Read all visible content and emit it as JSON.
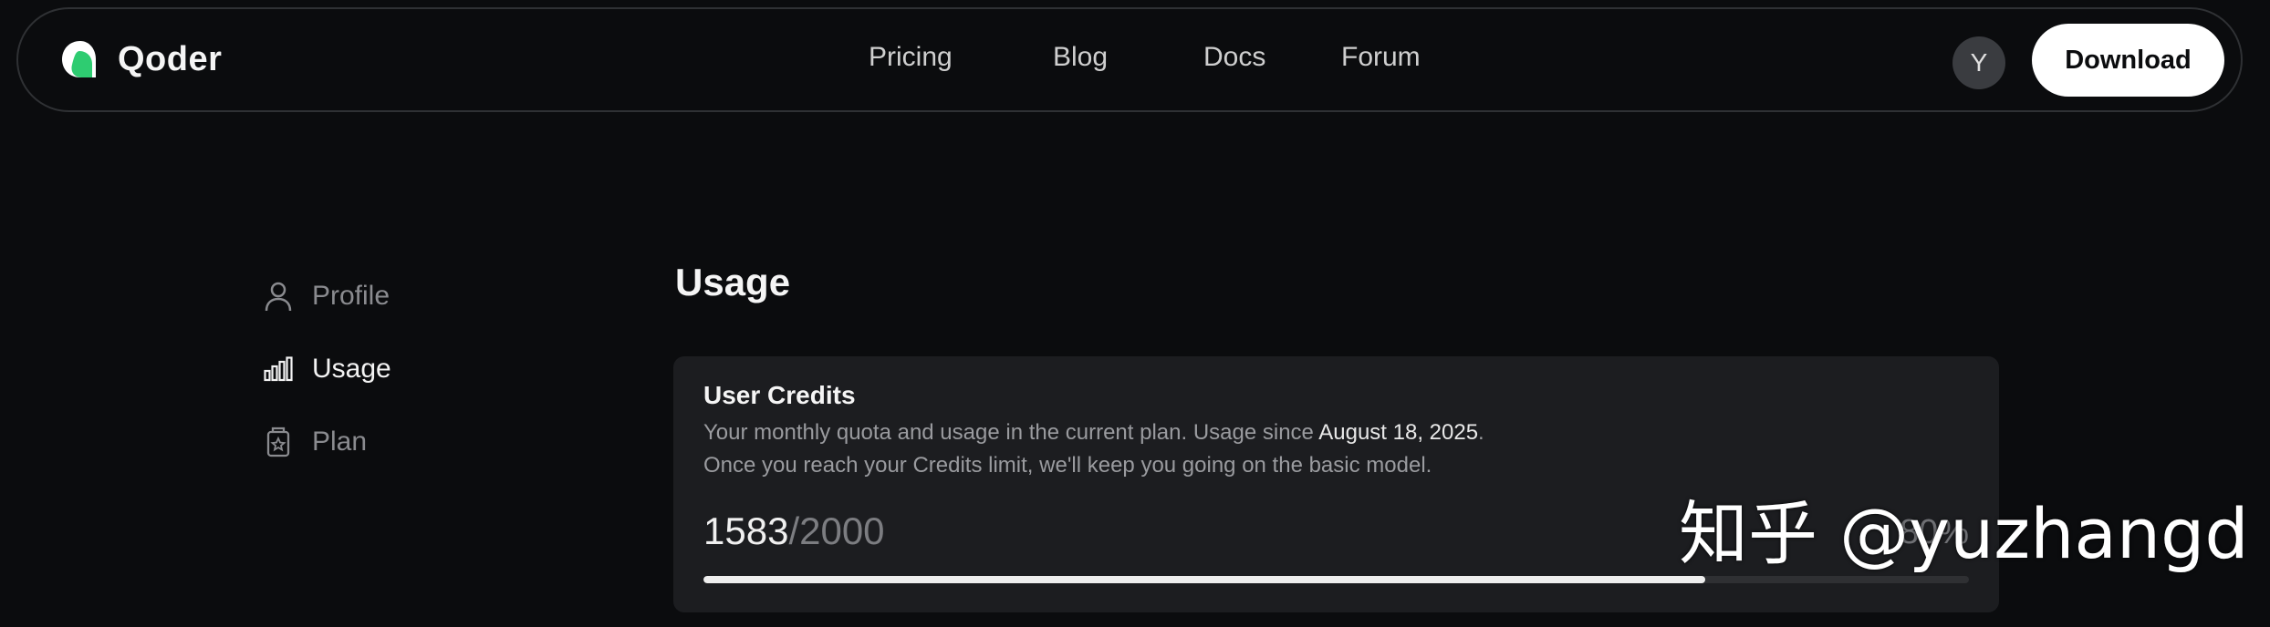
{
  "brand": {
    "name": "Qoder",
    "logo_icon": "qoder-logo-icon",
    "accent": "#2ecc71"
  },
  "nav": {
    "links": [
      "Pricing",
      "Blog",
      "Docs",
      "Forum"
    ],
    "avatar_initial": "Y",
    "download_label": "Download"
  },
  "sidebar": {
    "items": [
      {
        "label": "Profile",
        "icon": "user-icon",
        "active": false
      },
      {
        "label": "Usage",
        "icon": "bar-chart-icon",
        "active": true
      },
      {
        "label": "Plan",
        "icon": "plan-card-icon",
        "active": false
      }
    ]
  },
  "main": {
    "title": "Usage",
    "card": {
      "title": "User Credits",
      "desc_line1_prefix": "Your monthly quota and usage in the current plan. Usage since ",
      "since_date": "August 18, 2025",
      "desc_line1_suffix": ".",
      "desc_line2": "Once you reach your Credits limit, we'll keep you going on the basic model.",
      "used": "1583",
      "total": "/2000",
      "percent": "80%",
      "progress_fraction": 0.7915
    }
  },
  "watermark": "知乎 @yuzhangd"
}
